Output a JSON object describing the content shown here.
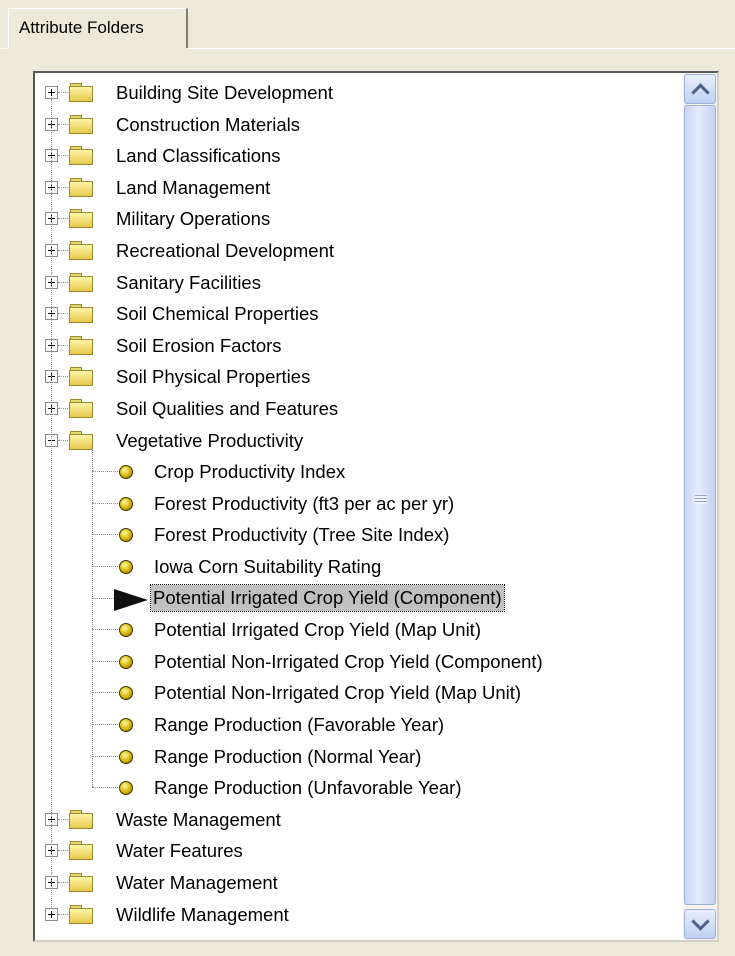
{
  "tab": {
    "label": "Attribute Folders"
  },
  "tree": {
    "folders_before": [
      "Building Site Development",
      "Construction Materials",
      "Land Classifications",
      "Land Management",
      "Military Operations",
      "Recreational Development",
      "Sanitary Facilities",
      "Soil Chemical Properties",
      "Soil Erosion Factors",
      "Soil Physical Properties",
      "Soil Qualities and Features"
    ],
    "expanded_folder": {
      "label": "Vegetative Productivity",
      "children": [
        {
          "label": "Crop Productivity Index",
          "icon": "bullet-icon"
        },
        {
          "label": "Forest Productivity (ft3 per ac per yr)",
          "icon": "bullet-icon"
        },
        {
          "label": "Forest Productivity (Tree Site Index)",
          "icon": "bullet-icon"
        },
        {
          "label": "Iowa Corn Suitability Rating",
          "icon": "bullet-icon"
        },
        {
          "label": "Potential Irrigated Crop Yield (Component)",
          "icon": "pointer-arrow-icon",
          "selected": true
        },
        {
          "label": "Potential Irrigated Crop Yield (Map Unit)",
          "icon": "bullet-icon"
        },
        {
          "label": "Potential Non-Irrigated Crop Yield (Component)",
          "icon": "bullet-icon"
        },
        {
          "label": "Potential Non-Irrigated Crop Yield (Map Unit)",
          "icon": "bullet-icon"
        },
        {
          "label": "Range Production (Favorable Year)",
          "icon": "bullet-icon"
        },
        {
          "label": "Range Production (Normal Year)",
          "icon": "bullet-icon"
        },
        {
          "label": "Range Production (Unfavorable Year)",
          "icon": "bullet-icon"
        }
      ]
    },
    "folders_after": [
      "Waste Management",
      "Water Features",
      "Water Management",
      "Wildlife Management"
    ]
  },
  "colors": {
    "panel": "#ece9d8",
    "selection": "#c0c0c0",
    "folder": "#e6c94a"
  }
}
